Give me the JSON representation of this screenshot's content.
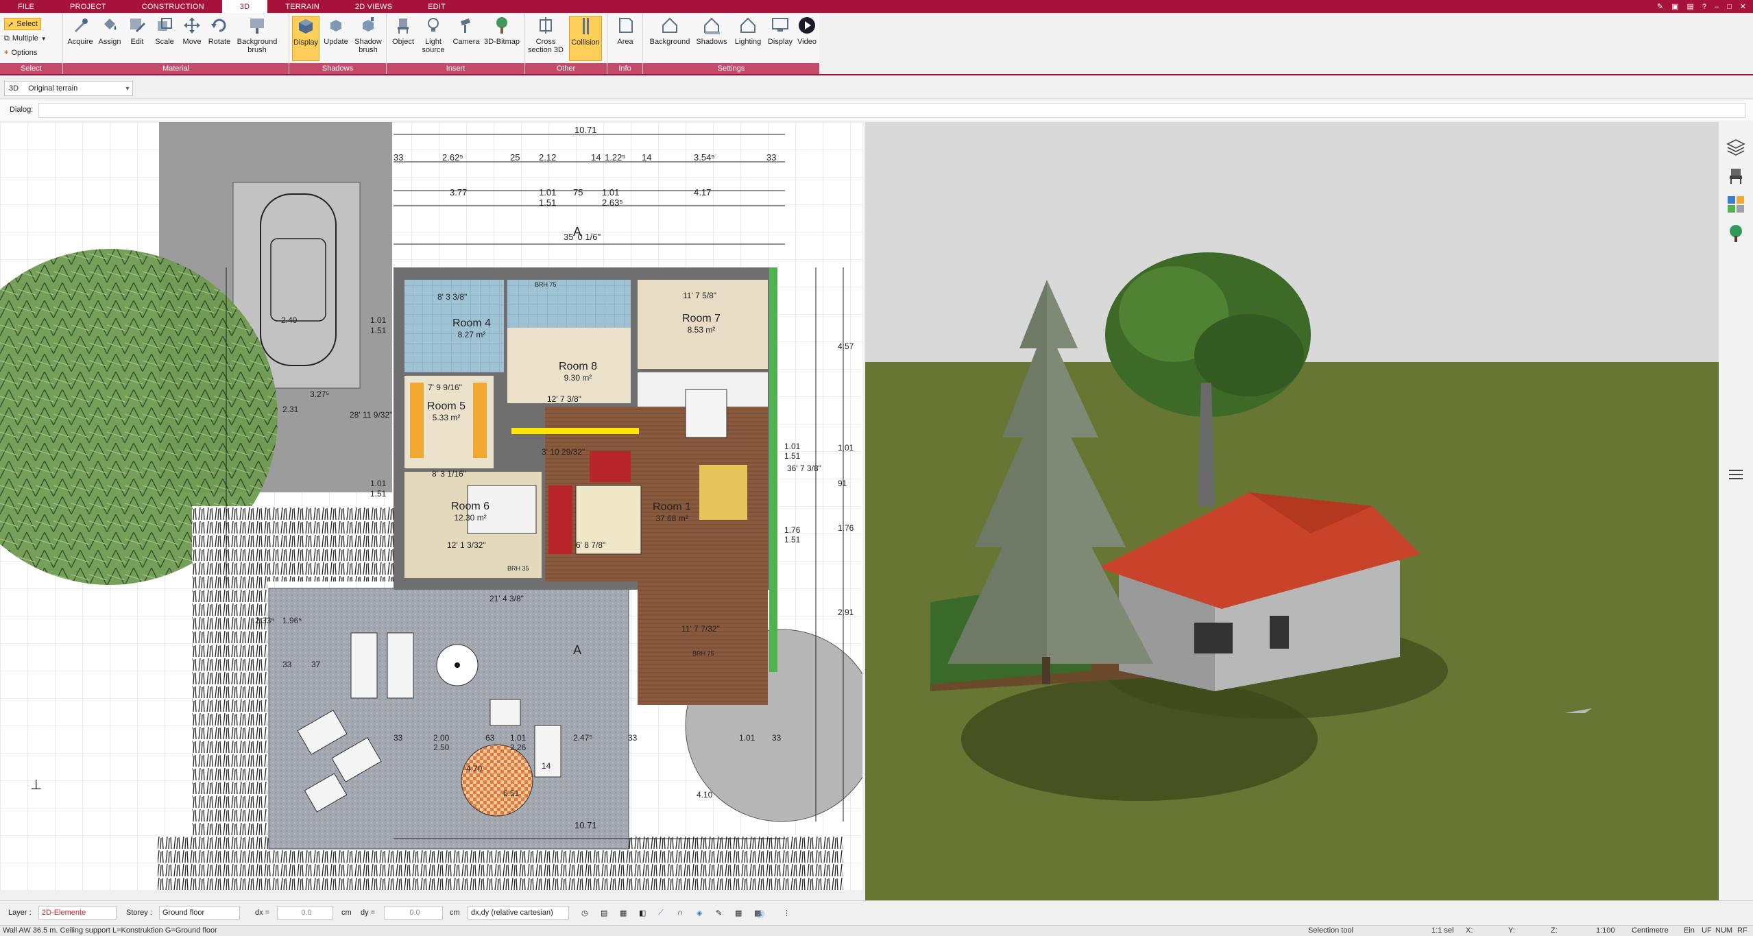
{
  "menu": {
    "tabs": [
      "FILE",
      "PROJECT",
      "CONSTRUCTION",
      "3D",
      "TERRAIN",
      "2D VIEWS",
      "EDIT"
    ],
    "active": "3D"
  },
  "ribbon": {
    "select": {
      "select": "Select",
      "multiple": "Multiple",
      "options": "Options",
      "label": "Select"
    },
    "material": {
      "label": "Material",
      "buttons": [
        "Acquire",
        "Assign",
        "Edit",
        "Scale",
        "Move",
        "Rotate",
        "Background brush"
      ]
    },
    "shadows": {
      "label": "Shadows",
      "buttons": [
        "Display",
        "Update",
        "Shadow brush"
      ]
    },
    "insert": {
      "label": "Insert",
      "buttons": [
        "Object",
        "Light source",
        "Camera",
        "3D-Bitmap"
      ]
    },
    "other": {
      "label": "Other",
      "buttons": [
        "Cross section 3D",
        "Collision"
      ]
    },
    "info": {
      "label": "Info",
      "buttons": [
        "Area"
      ]
    },
    "settings": {
      "label": "Settings",
      "buttons": [
        "Background",
        "Shadows",
        "Lighting",
        "Display",
        "Video"
      ]
    }
  },
  "view_combo": {
    "mode": "3D",
    "value": "Original terrain"
  },
  "dialog": {
    "label": "Dialog:"
  },
  "plan": {
    "dims_top": [
      "10.71",
      "2.62⁵",
      "25",
      "2.12",
      "14",
      "1.22⁵",
      "14",
      "3.54⁵",
      "33",
      "33",
      "3.77",
      "1.01",
      "1.51",
      "75",
      "1.01",
      "2.63⁵",
      "4.17",
      "35' 0 1/6\""
    ],
    "dims_left": [
      "1.01",
      "1.51",
      "2.40",
      "3.27⁵",
      "2.31",
      "1.01",
      "1.51",
      "28' 11 9/32\""
    ],
    "dims_right": [
      "4.57",
      "1.01",
      "91",
      "1.76",
      "2.91",
      "1.01",
      "1.51",
      "1.76",
      "1.51",
      "36' 7 3/8\""
    ],
    "dims_bottom": [
      "21' 4 3/8\"",
      "2.33⁵",
      "1.96⁵",
      "33",
      "37",
      "2.00",
      "2.50",
      "63",
      "1.01",
      "2.26",
      "2.47⁵",
      "33",
      "33",
      "10.71",
      "4.70",
      "6.51",
      "14",
      "1.01",
      "33",
      "4.10",
      "11' 7 7/32\""
    ],
    "rooms": [
      {
        "name": "Room 4",
        "area": "8.27 m²",
        "dim": "8' 3 3/8\""
      },
      {
        "name": "Room 7",
        "area": "8.53 m²",
        "dim": "11' 7 5/8\""
      },
      {
        "name": "Room 8",
        "area": "9.30 m²",
        "dim": "12' 7 3/8\""
      },
      {
        "name": "Room 5",
        "area": "5.33 m²",
        "dim": "7' 9 9/16\""
      },
      {
        "name": "Room 6",
        "area": "12.30 m²",
        "dim": "12' 1 3/32\""
      },
      {
        "name": "Room 1",
        "area": "37.68 m²",
        "dim": "3' 10 29/32\""
      }
    ],
    "labels": [
      "BRH 75",
      "BRH 75",
      "BRH 35",
      "A",
      "A",
      "8' 3 1/16\"",
      "6' 8 7/8\""
    ]
  },
  "status": {
    "layer_label": "Layer :",
    "layer_value": "2D-Elemente",
    "storey_label": "Storey :",
    "storey_value": "Ground floor",
    "dx_label": "dx =",
    "dx_value": "0.0",
    "dy_label": "dy =",
    "dy_value": "0.0",
    "unit": "cm",
    "coord_mode": "dx,dy (relative cartesian)"
  },
  "bottombar": {
    "message": "Wall AW 36.5 m. Ceiling support L=Konstruktion G=Ground floor",
    "tool": "Selection tool",
    "sel": "1:1 sel",
    "x": "X:",
    "y": "Y:",
    "z": "Z:",
    "scale": "1:100",
    "unit": "Centimetre",
    "ein": "Ein",
    "uf": "UF",
    "num": "NUM",
    "rf": "RF"
  },
  "colors": {
    "brand": "#a7123a",
    "ribbon_label": "#c44a6a",
    "highlight": "#ffcf5a",
    "roof": "#c8432a",
    "lawn": "#6b7a35",
    "sky": "#d9d9d9"
  }
}
